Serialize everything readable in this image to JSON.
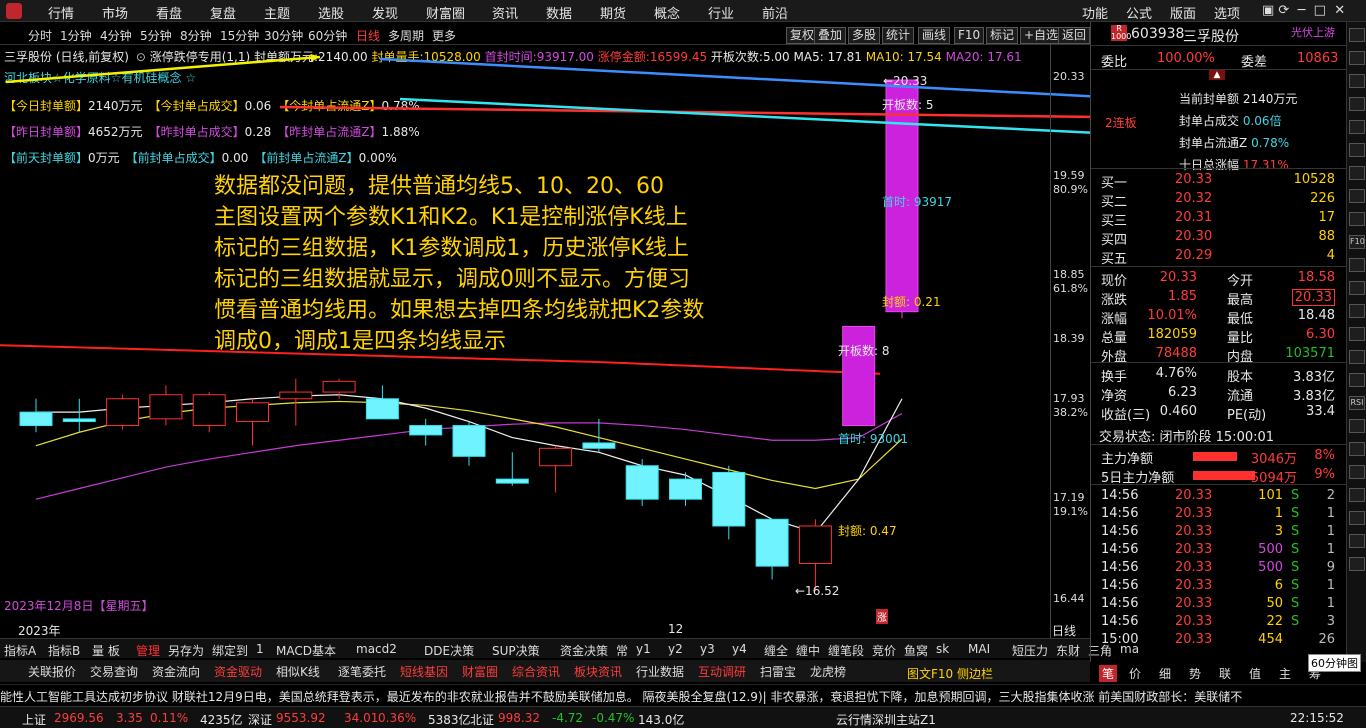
{
  "menu": {
    "items": [
      "行情",
      "市场",
      "看盘",
      "复盘",
      "主题",
      "选股",
      "发现",
      "财富圈",
      "资讯",
      "数据",
      "期货",
      "概念",
      "行业",
      "前沿"
    ],
    "right": [
      "功能",
      "公式",
      "版面",
      "选项"
    ]
  },
  "timeframes": [
    "分时",
    "1分钟",
    "4分钟",
    "5分钟",
    "8分钟",
    "15分钟",
    "30分钟",
    "60分钟",
    "日线",
    "多周期",
    "更多"
  ],
  "toolbar": [
    "复权",
    "叠加",
    "多股",
    "统计",
    "画线",
    "F10",
    "标记",
    "+自选",
    "返回"
  ],
  "indicator_line": {
    "name": "三孚股份 (日线,前复权)",
    "formula": "涨停跌停专用(1,1)",
    "seal_amount_label": "封单额万元:",
    "seal_amount": "2140.00",
    "seal_hand_label": "封单量手:",
    "seal_hand": "10528.00",
    "first_time_label": "首封时间:",
    "first_time": "93917.00",
    "limit_amount_label": "涨停金额:",
    "limit_amount": "16599.45",
    "open_count_label": "开板次数:",
    "open_count": "5.00",
    "ma5": "MA5: 17.81",
    "ma10": "MA10: 17.54",
    "ma20": "MA20: 17.61"
  },
  "concepts": "河北板块☆化学原料☆有机硅概念 ☆",
  "seal_rows": [
    {
      "a": "【今日封单额】",
      "av": "2140万元",
      "b": "【今封单占成交】",
      "bv": "0.06",
      "c": "【今封单占流通Z】",
      "cv": "0.78%"
    },
    {
      "a": "【昨日封单额】",
      "av": "4652万元",
      "b": "【昨封单占成交】",
      "bv": "0.28",
      "c": "【昨封单占流通Z】",
      "cv": "1.88%"
    },
    {
      "a": "【前天封单额】",
      "av": "0万元",
      "b": "【前封单占成交】",
      "bv": "0.00",
      "c": "【前封单占流通Z】",
      "cv": "0.00%"
    }
  ],
  "note": [
    "数据都没问题，提供普通均线5、10、20、60",
    "主图设置两个参数K1和K2。K1是控制涨停K线上",
    "标记的三组数据，K1参数调成1，历史涨停K线上",
    "标记的三组数据就显示，调成0则不显示。方便习",
    "惯看普通均线用。如果想去掉四条均线就把K2参数",
    "调成0，调成1是四条均线显示"
  ],
  "chart_marks": {
    "high": "20.33",
    "open_count_top": "开板数: 5",
    "first_time_top": "首时: 93917",
    "seal_top": "封额: 0.21",
    "open_count_mid": "开板数: 8",
    "first_time_low": "首时: 93001",
    "seal_low": "封额: 0.47",
    "low": "16.52",
    "date": "2023年12月8日【星期五】",
    "zhang": "涨",
    "year": "2023年",
    "month": "12",
    "period": "日线"
  },
  "y_axis": [
    {
      "v": "20.33"
    },
    {
      "v": "19.59",
      "p": "80.9%"
    },
    {
      "v": "18.85",
      "p": "61.8%"
    },
    {
      "v": "18.39"
    },
    {
      "v": "17.93",
      "p": "38.2%"
    },
    {
      "v": "17.19",
      "p": "19.1%"
    },
    {
      "v": "16.44"
    }
  ],
  "chart_data": {
    "type": "candlestick",
    "ma": [
      5,
      10,
      20,
      60
    ],
    "bars": [
      {
        "o": 17.85,
        "h": 17.95,
        "l": 17.7,
        "c": 17.75
      },
      {
        "o": 17.8,
        "h": 17.95,
        "l": 17.7,
        "c": 17.78
      },
      {
        "o": 17.75,
        "h": 17.98,
        "l": 17.72,
        "c": 17.95
      },
      {
        "o": 17.8,
        "h": 18.05,
        "l": 17.75,
        "c": 17.98
      },
      {
        "o": 17.75,
        "h": 18.0,
        "l": 17.7,
        "c": 17.98
      },
      {
        "o": 17.78,
        "h": 17.95,
        "l": 17.6,
        "c": 17.92
      },
      {
        "o": 17.95,
        "h": 18.1,
        "l": 17.75,
        "c": 18.0
      },
      {
        "o": 18.0,
        "h": 18.1,
        "l": 17.95,
        "c": 18.08
      },
      {
        "o": 17.95,
        "h": 18.05,
        "l": 17.85,
        "c": 17.8
      },
      {
        "o": 17.75,
        "h": 17.8,
        "l": 17.6,
        "c": 17.68
      },
      {
        "o": 17.75,
        "h": 17.78,
        "l": 17.45,
        "c": 17.52
      },
      {
        "o": 17.35,
        "h": 17.55,
        "l": 17.3,
        "c": 17.32
      },
      {
        "o": 17.45,
        "h": 17.6,
        "l": 17.25,
        "c": 17.58
      },
      {
        "o": 17.62,
        "h": 17.8,
        "l": 17.55,
        "c": 17.58
      },
      {
        "o": 17.45,
        "h": 17.5,
        "l": 17.15,
        "c": 17.2
      },
      {
        "o": 17.35,
        "h": 17.4,
        "l": 17.15,
        "c": 17.2
      },
      {
        "o": 17.4,
        "h": 17.45,
        "l": 16.9,
        "c": 17.0
      },
      {
        "o": 17.05,
        "h": 17.05,
        "l": 16.6,
        "c": 16.7
      },
      {
        "o": 16.72,
        "h": 17.05,
        "l": 16.52,
        "c": 17.0
      },
      {
        "o": 17.75,
        "h": 18.49,
        "l": 17.85,
        "c": 18.49
      },
      {
        "o": 18.6,
        "h": 20.33,
        "l": 18.55,
        "c": 20.33
      }
    ]
  },
  "quote": {
    "code": "603938",
    "name": "三孚股份",
    "tag": "光伏上游",
    "webi_label": "委比",
    "webi": "100.00%",
    "wecha_label": "委差",
    "wecha": "10863",
    "current_seal_label": "当前封单额",
    "current_seal": "2140万元",
    "seal_trade_label": "封单占成交",
    "seal_trade": "0.06倍",
    "lianban": "2连板",
    "seal_float_label": "封单占流通Z",
    "seal_float": "0.78%",
    "ten_day_label": "十日总涨幅",
    "ten_day": "17.31%",
    "bids": [
      {
        "l": "买一",
        "p": "20.33",
        "v": "10528"
      },
      {
        "l": "买二",
        "p": "20.32",
        "v": "226"
      },
      {
        "l": "买三",
        "p": "20.31",
        "v": "17"
      },
      {
        "l": "买四",
        "p": "20.30",
        "v": "88"
      },
      {
        "l": "买五",
        "p": "20.29",
        "v": "4"
      }
    ],
    "stats": [
      {
        "a": "现价",
        "av": "20.33",
        "b": "今开",
        "bv": "18.58"
      },
      {
        "a": "涨跌",
        "av": "1.85",
        "b": "最高",
        "bv": "20.33"
      },
      {
        "a": "涨幅",
        "av": "10.01%",
        "b": "最低",
        "bv": "18.48"
      },
      {
        "a": "总量",
        "av": "182059",
        "b": "量比",
        "bv": "6.30"
      },
      {
        "a": "外盘",
        "av": "78488",
        "b": "内盘",
        "bv": "103571"
      }
    ],
    "stats2": [
      {
        "a": "换手",
        "av": "4.76%",
        "b": "股本",
        "bv": "3.83亿"
      },
      {
        "a": "净资",
        "av": "6.23",
        "b": "流通",
        "bv": "3.83亿"
      },
      {
        "a": "收益(三)",
        "av": "0.460",
        "b": "PE(动)",
        "bv": "33.4"
      }
    ],
    "trade_state": "交易状态: 闭市阶段 15:00:01",
    "flow": [
      {
        "l": "主力净额",
        "v": "3046万",
        "p": "8%"
      },
      {
        "l": "5日主力净额",
        "v": "5094万",
        "p": "9%"
      }
    ],
    "ticks": [
      {
        "t": "14:56",
        "p": "20.33",
        "v": "101",
        "s": "S",
        "n": "2"
      },
      {
        "t": "14:56",
        "p": "20.33",
        "v": "1",
        "s": "S",
        "n": "1"
      },
      {
        "t": "14:56",
        "p": "20.33",
        "v": "3",
        "s": "S",
        "n": "1"
      },
      {
        "t": "14:56",
        "p": "20.33",
        "v": "500",
        "s": "S",
        "n": "1"
      },
      {
        "t": "14:56",
        "p": "20.33",
        "v": "500",
        "s": "S",
        "n": "9"
      },
      {
        "t": "14:56",
        "p": "20.33",
        "v": "6",
        "s": "S",
        "n": "1"
      },
      {
        "t": "14:56",
        "p": "20.33",
        "v": "50",
        "s": "S",
        "n": "1"
      },
      {
        "t": "14:56",
        "p": "20.33",
        "v": "22",
        "s": "S",
        "n": "3"
      },
      {
        "t": "15:00",
        "p": "20.33",
        "v": "454",
        "s": "",
        "n": "26"
      }
    ]
  },
  "bottom_tabs": [
    "指标A",
    "指标B",
    "量 板",
    "管理",
    "另存为",
    "绑定到",
    "1",
    "MACD基本",
    "macd2",
    "DDE决策",
    "SUP决策",
    "资金决策",
    "常",
    "y1",
    "y2",
    "y3",
    "y4",
    "缠全",
    "缠中",
    "缠笔段",
    "竞价",
    "鱼窝",
    "sk",
    "MAI",
    "短压力",
    "东财",
    "三角",
    "ma"
  ],
  "bottom_tabs2": [
    "关联报价",
    "交易查询",
    "资金流向",
    "资金驱动",
    "相似K线",
    "逐笔委托",
    "短线基因",
    "财富圈",
    "综合资讯",
    "板块资讯",
    "行业数据",
    "互动调研",
    "扫雷宝",
    "龙虎榜"
  ],
  "right_tabs": [
    "图文F10",
    "侧边栏",
    "笔",
    "价",
    "细",
    "势",
    "联",
    "值",
    "主",
    "筹"
  ],
  "tip_60": "60分钟图",
  "ticker_text": "能性人工智能工具达成初步协议      财联社12月9日电，美国总统拜登表示，最近发布的非农就业报告并不鼓励美联储加息。      隔夜美股全复盘(12.9)| 非农暴涨，衰退担忧下降，加息预期回调，三大股指集体收涨      前美国财政部长：美联储不",
  "status_bar": {
    "sh_label": "上证",
    "sh": "2969.56",
    "sh_ch": "3.35",
    "sh_pct": "0.11%",
    "sh_amt": "4235亿",
    "sz_label": "深证",
    "sz": "9553.92",
    "sz_ch": "34.01",
    "sz_pct": "0.36%",
    "sz_amt": "5383亿",
    "bz_label": "北证",
    "bz": "998.32",
    "bz_ch": "-4.72",
    "bz_pct": "-0.47%",
    "bz_amt": "143.0亿",
    "server": "云行情深圳主站Z1",
    "time": "22:15:52"
  },
  "sidebar_icons": [
    "F10",
    "RSI"
  ]
}
